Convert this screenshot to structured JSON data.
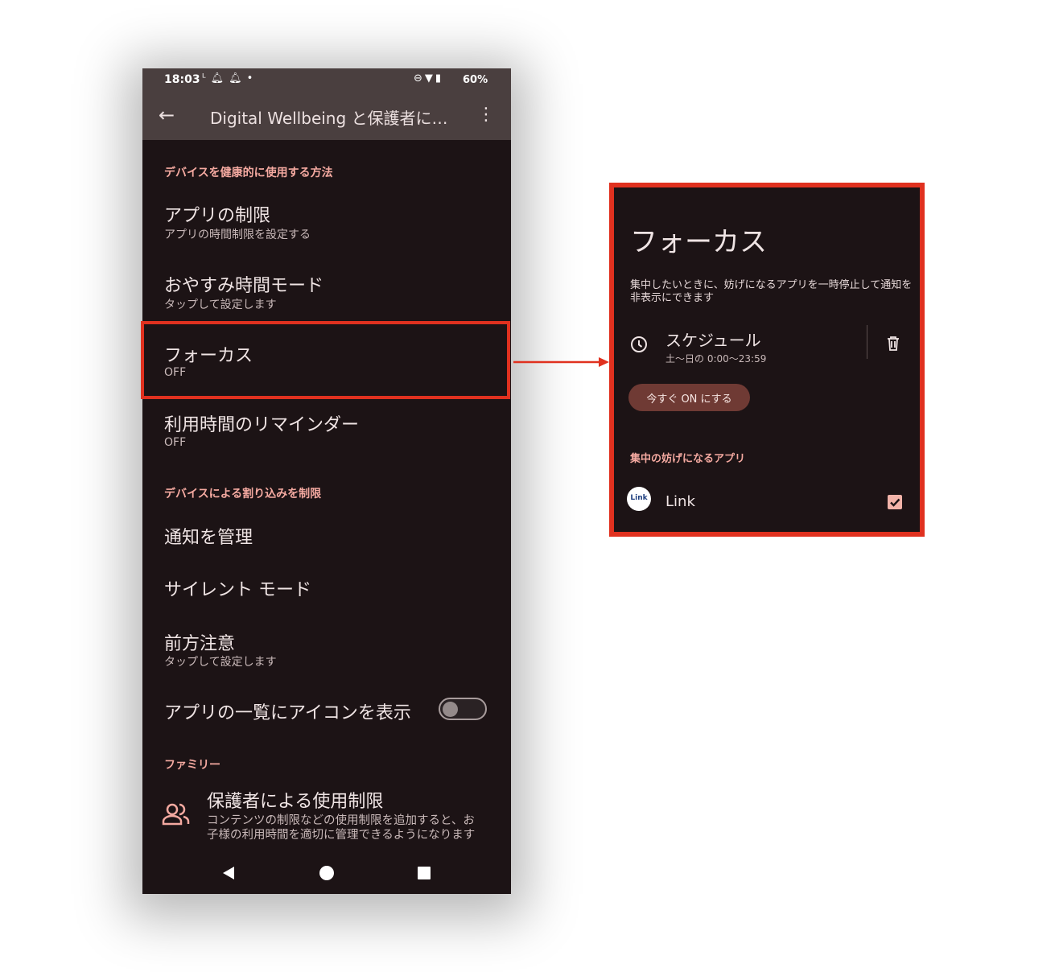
{
  "status_bar": {
    "time": "18:03",
    "battery": "60%",
    "left_icons": [
      "link-app-icon",
      "bell-icon",
      "bell-icon",
      "dot-icon"
    ],
    "right_icons": [
      "do-not-disturb-icon",
      "wifi-icon",
      "battery-icon"
    ]
  },
  "app_bar": {
    "title": "Digital Wellbeing と保護者に…"
  },
  "sections": {
    "wellbeing_header": "デバイスを健康的に使用する方法",
    "interruptions_header": "デバイスによる割り込みを制限",
    "family_header": "ファミリー"
  },
  "items": {
    "app_limits": {
      "title": "アプリの制限",
      "subtitle": "アプリの時間制限を設定する"
    },
    "bedtime": {
      "title": "おやすみ時間モード",
      "subtitle": "タップして設定します"
    },
    "focus": {
      "title": "フォーカス",
      "subtitle": "OFF"
    },
    "reminder": {
      "title": "利用時間のリマインダー",
      "subtitle": "OFF"
    },
    "notifications": {
      "title": "通知を管理"
    },
    "silent": {
      "title": "サイレント モード"
    },
    "heads_up": {
      "title": "前方注意",
      "subtitle": "タップして設定します"
    },
    "show_icon": {
      "title": "アプリの一覧にアイコンを表示",
      "toggle_on": false
    },
    "parental": {
      "title": "保護者による使用制限",
      "subtitle_line1": "コンテンツの制限などの使用制限を追加すると、お",
      "subtitle_line2": "子様の利用時間を適切に管理できるようになります"
    }
  },
  "detail": {
    "title": "フォーカス",
    "description": "集中したいときに、妨げになるアプリを一時停止して通知を非表示にできます",
    "schedule_title": "スケジュール",
    "schedule_sub": "土〜日の 0:00〜23:59",
    "turn_on_button": "今すぐ ON にする",
    "apps_header": "集中の妨げになるアプリ",
    "app_logo_text": "Link",
    "app_name": "Link",
    "app_checked": true
  },
  "colors": {
    "accent_red": "#e0311f",
    "section_pink": "#f4a9a0",
    "background": "#1c1315",
    "app_bar": "#4a3f3f"
  }
}
